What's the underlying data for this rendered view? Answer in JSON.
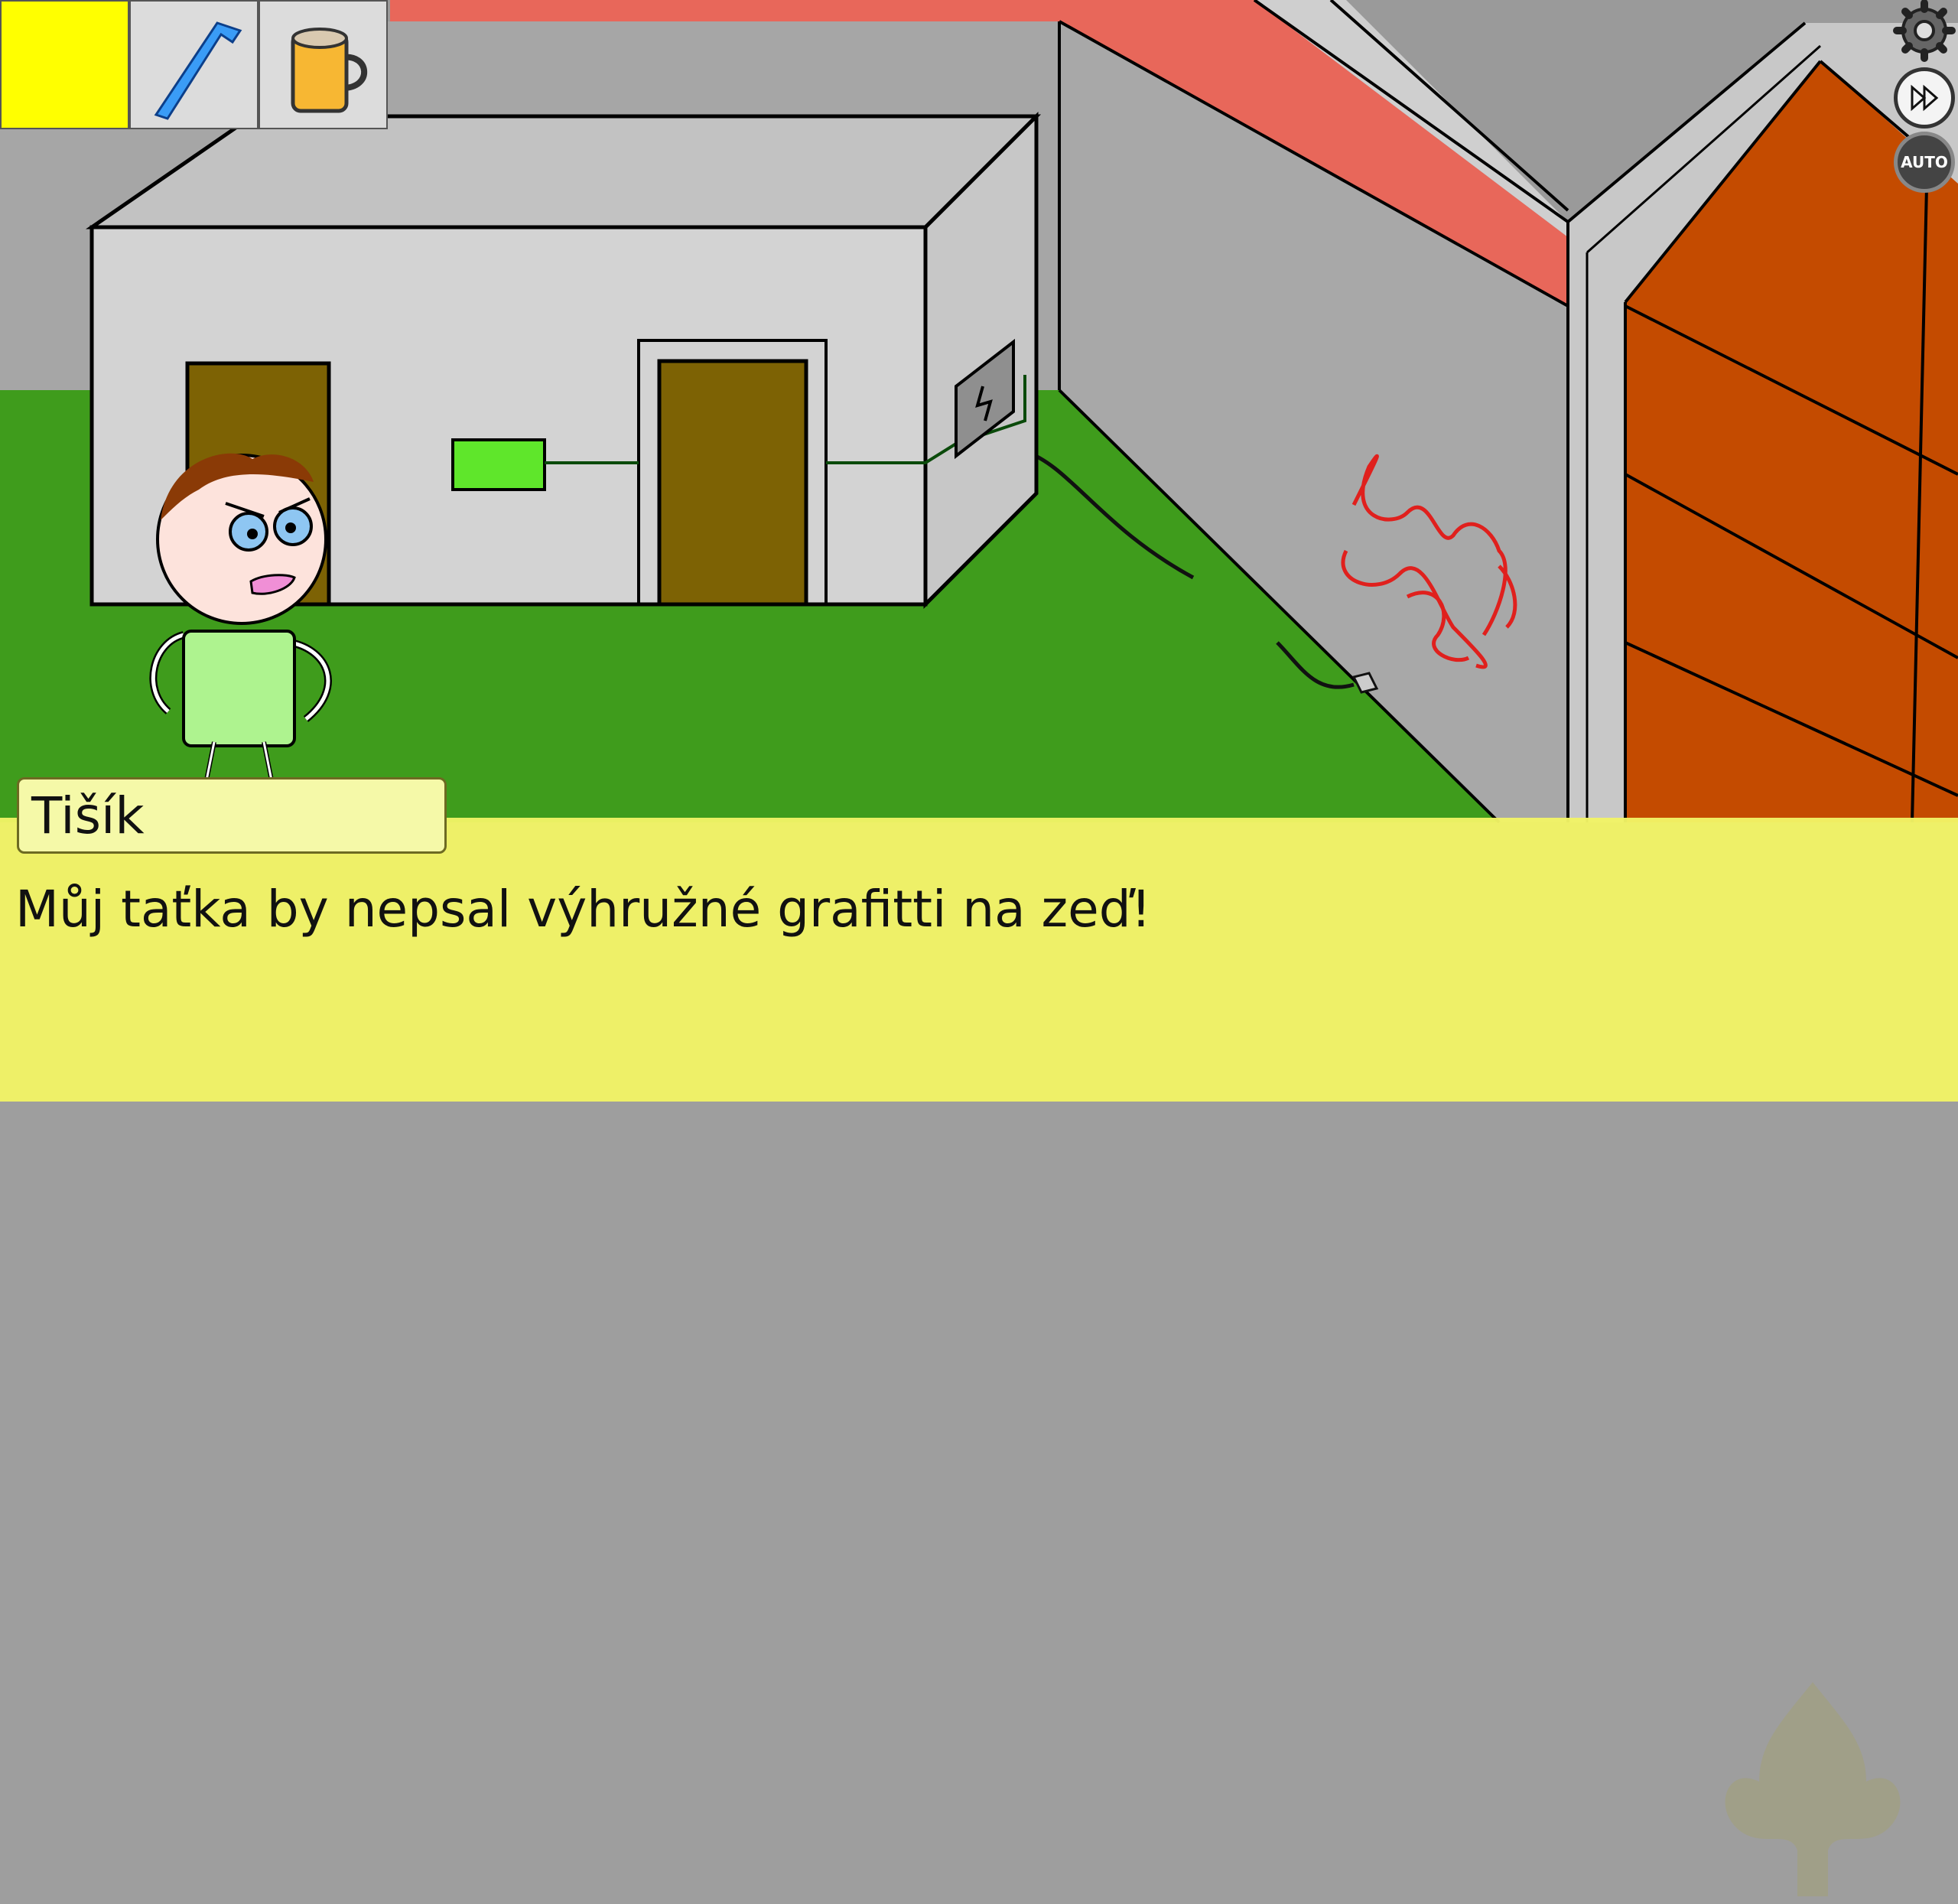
{
  "inventory": {
    "items": [
      {
        "name": "empty-slot",
        "icon": "empty-slot",
        "selected": true
      },
      {
        "name": "hex-key",
        "icon": "hex-key-icon",
        "selected": false
      },
      {
        "name": "mug",
        "icon": "mug-icon",
        "selected": false
      }
    ]
  },
  "controls": {
    "settings_icon": "gear-icon",
    "skip_icon": "fast-forward-icon",
    "auto_label": "AUTO"
  },
  "dialog": {
    "speaker": "Tišík",
    "text": "Můj taťka by nepsal výhružné grafitti na zeď!"
  },
  "colors": {
    "dialog_bg": "#f1f466",
    "grass": "#3f9c1c",
    "wall_red": "#e8675a",
    "door_orange": "#c44b00"
  }
}
